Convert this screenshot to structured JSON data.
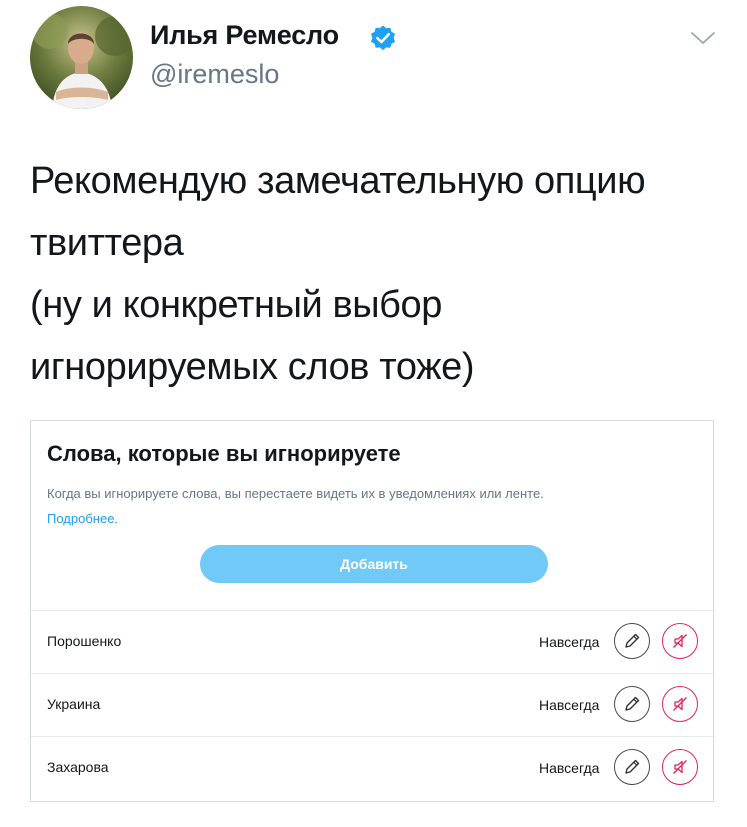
{
  "tweet": {
    "author_name": "Илья Ремесло",
    "author_handle": "@iremeslo",
    "text_lines": [
      "Рекомендую замечательную опцию",
      "твиттера",
      "(ну и конкретный выбор",
      "игнорируемых слов тоже)"
    ]
  },
  "muted_words_panel": {
    "title": "Слова, которые вы игнорируете",
    "description": "Когда вы игнорируете слова, вы перестаете видеть их в уведомлениях или ленте.",
    "learn_more": "Подробнее.",
    "add_button": "Добавить",
    "rows": [
      {
        "word": "Порошенко",
        "duration": "Навсегда"
      },
      {
        "word": "Украина",
        "duration": "Навсегда"
      },
      {
        "word": "Захарова",
        "duration": "Навсегда"
      }
    ]
  },
  "icons": {
    "verified": "verified-badge-icon",
    "caret": "chevron-down-icon",
    "edit": "pencil-icon",
    "unmute": "speaker-muted-icon"
  },
  "colors": {
    "accent": "#1da1f2",
    "button": "#71c9f8",
    "unmute": "#e0245e",
    "secondary_text": "#657786"
  }
}
